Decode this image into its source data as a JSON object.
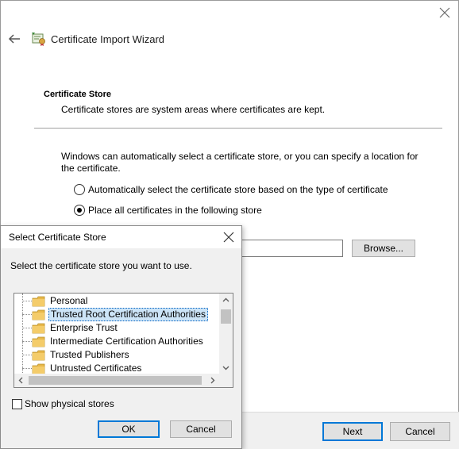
{
  "wizard": {
    "title": "Certificate Import Wizard",
    "section_heading": "Certificate Store",
    "section_desc": "Certificate stores are system areas where certificates are kept.",
    "body_text": "Windows can automatically select a certificate store, or you can specify a location for the certificate.",
    "radio_auto": "Automatically select the certificate store based on the type of certificate",
    "radio_place": "Place all certificates in the following store",
    "radio_selected": "place",
    "store_value": "",
    "browse_label": "Browse...",
    "next_label": "Next",
    "cancel_label": "Cancel"
  },
  "dialog": {
    "title": "Select Certificate Store",
    "prompt": "Select the certificate store you want to use.",
    "stores": [
      {
        "label": "Personal",
        "selected": false
      },
      {
        "label": "Trusted Root Certification Authorities",
        "selected": true
      },
      {
        "label": "Enterprise Trust",
        "selected": false
      },
      {
        "label": "Intermediate Certification Authorities",
        "selected": false
      },
      {
        "label": "Trusted Publishers",
        "selected": false
      },
      {
        "label": "Untrusted Certificates",
        "selected": false
      }
    ],
    "show_physical_label": "Show physical stores",
    "show_physical_checked": false,
    "ok_label": "OK",
    "cancel_label": "Cancel"
  },
  "icons": {
    "window_close": "close-icon",
    "back": "back-arrow-icon",
    "wizard": "certificate-icon",
    "folder": "folder-icon"
  },
  "colors": {
    "accent": "#0078d7",
    "selection": "#cce4f7",
    "folder": "#f4cc6a"
  }
}
